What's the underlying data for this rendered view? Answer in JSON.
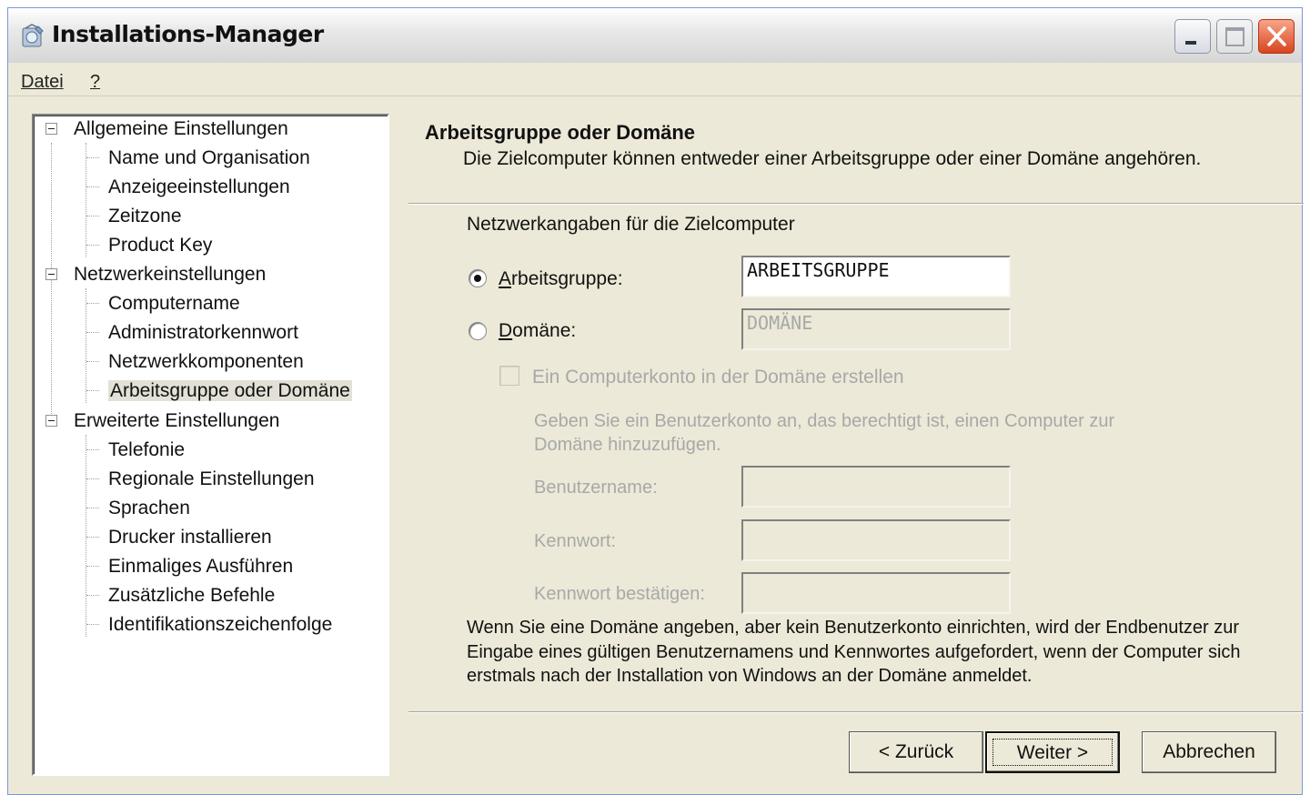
{
  "window": {
    "title": "Installations-Manager",
    "icon": "setup-manager-icon"
  },
  "menu": {
    "file": "Datei",
    "help": "?"
  },
  "tree": {
    "groups": [
      {
        "label": "Allgemeine Einstellungen",
        "items": [
          "Name und Organisation",
          "Anzeigeeinstellungen",
          "Zeitzone",
          "Product Key"
        ]
      },
      {
        "label": "Netzwerkeinstellungen",
        "items": [
          "Computername",
          "Administratorkennwort",
          "Netzwerkkomponenten",
          "Arbeitsgruppe oder Domäne"
        ]
      },
      {
        "label": "Erweiterte Einstellungen",
        "items": [
          "Telefonie",
          "Regionale Einstellungen",
          "Sprachen",
          "Drucker installieren",
          "Einmaliges Ausführen",
          "Zusätzliche Befehle",
          "Identifikationszeichenfolge"
        ]
      }
    ],
    "selected": "Arbeitsgruppe oder Domäne"
  },
  "page": {
    "title": "Arbeitsgruppe oder Domäne",
    "subtitle": "Die Zielcomputer können entweder einer Arbeitsgruppe oder einer Domäne angehören.",
    "section_label": "Netzwerkangaben für die Zielcomputer",
    "workgroup_label": "Arbeitsgruppe:",
    "workgroup_value": "ARBEITSGRUPPE",
    "domain_label": "Domäne:",
    "domain_value": "DOMÄNE",
    "selected_option": "Arbeitsgruppe",
    "create_account_label": "Ein Computerkonto in der Domäne erstellen",
    "create_account_checked": false,
    "account_hint": "Geben Sie ein Benutzerkonto an, das berechtigt ist, einen Computer zur Domäne hinzuzufügen.",
    "username_label": "Benutzername:",
    "username_value": "",
    "password_label": "Kennwort:",
    "password_value": "",
    "confirm_label": "Kennwort bestätigen:",
    "confirm_value": "",
    "note": "Wenn Sie eine Domäne angeben, aber kein Benutzerkonto einrichten, wird der Endbenutzer zur Eingabe eines gültigen Benutzernamens und Kennwortes aufgefordert, wenn der Computer sich erstmals nach der Installation von Windows an der Domäne anmeldet."
  },
  "buttons": {
    "back": "< Zurück",
    "next": "Weiter >",
    "cancel": "Abbrechen"
  },
  "colors": {
    "window_bg": "#ece9d8",
    "disabled_text": "#a8a8a8",
    "close_button": "#d8451e"
  }
}
